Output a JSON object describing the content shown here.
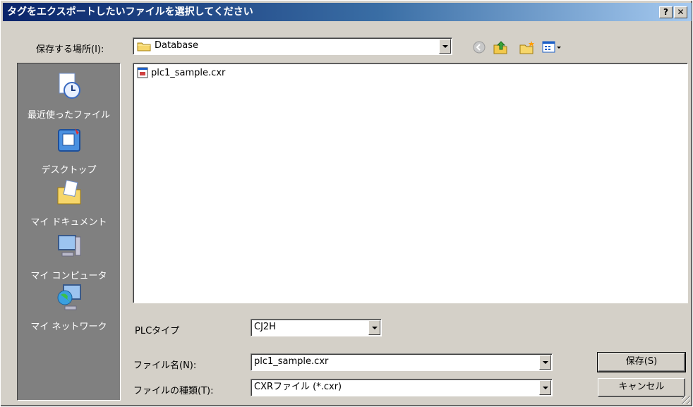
{
  "window": {
    "title": "タグをエクスポートしたいファイルを選択してください"
  },
  "title_buttons": {
    "help": "?",
    "close": "✕"
  },
  "save_in": {
    "label": "保存する場所(I):",
    "value": "Database"
  },
  "places": [
    {
      "label": "最近使ったファイル",
      "icon": "recent-files-icon"
    },
    {
      "label": "デスクトップ",
      "icon": "desktop-icon"
    },
    {
      "label": "マイ ドキュメント",
      "icon": "my-documents-icon"
    },
    {
      "label": "マイ コンピュータ",
      "icon": "my-computer-icon"
    },
    {
      "label": "マイ ネットワーク",
      "icon": "my-network-icon"
    }
  ],
  "files": [
    {
      "name": "plc1_sample.cxr"
    }
  ],
  "plc_type": {
    "label": "PLCタイプ",
    "value": "CJ2H"
  },
  "filename": {
    "label": "ファイル名(N):",
    "value": "plc1_sample.cxr"
  },
  "filetype": {
    "label": "ファイルの種類(T):",
    "value": "CXRファイル (*.cxr)"
  },
  "buttons": {
    "save": "保存(S)",
    "cancel": "キャンセル"
  }
}
